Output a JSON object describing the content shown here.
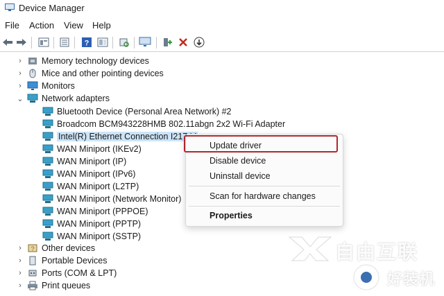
{
  "window": {
    "title": "Device Manager"
  },
  "menu": {
    "file": "File",
    "action": "Action",
    "view": "View",
    "help": "Help"
  },
  "toolbar": {
    "icons": [
      "back-arrow-icon",
      "forward-arrow-icon",
      "properties-sheet-icon",
      "details-icon",
      "help-icon",
      "show-hidden-icon",
      "scan-hardware-icon",
      "monitor-icon",
      "update-driver-icon",
      "uninstall-x-icon",
      "download-icon"
    ],
    "colors": {
      "uninstall": "#c42b1c",
      "help": "#2b5fb4"
    }
  },
  "tree": {
    "memory": "Memory technology devices",
    "mice": "Mice and other pointing devices",
    "monitors": "Monitors",
    "network": "Network adapters",
    "adapters": [
      "Bluetooth Device (Personal Area Network) #2",
      "Broadcom BCM943228HMB 802.11abgn 2x2 Wi-Fi Adapter",
      "Intel(R) Ethernet Connection I217-V",
      "WAN Miniport (IKEv2)",
      "WAN Miniport (IP)",
      "WAN Miniport (IPv6)",
      "WAN Miniport (L2TP)",
      "WAN Miniport (Network Monitor)",
      "WAN Miniport (PPPOE)",
      "WAN Miniport (PPTP)",
      "WAN Miniport (SSTP)"
    ],
    "other": "Other devices",
    "portable": "Portable Devices",
    "ports": "Ports (COM & LPT)",
    "print": "Print queues"
  },
  "context_menu": {
    "update": "Update driver",
    "disable": "Disable device",
    "uninstall": "Uninstall device",
    "scan": "Scan for hardware changes",
    "properties": "Properties",
    "highlight_color": "#b0262d"
  },
  "watermark": {
    "line1": "自由互联",
    "line2": "好装机"
  }
}
